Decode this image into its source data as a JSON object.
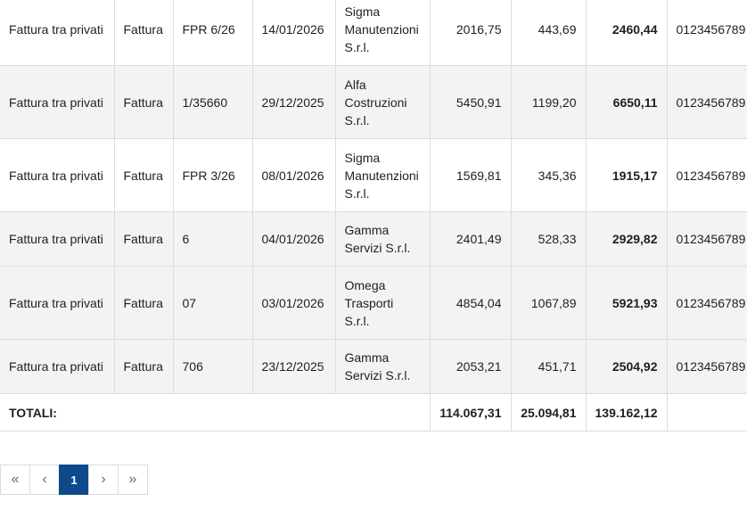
{
  "rows": [
    {
      "tipo": "Fattura tra privati",
      "documento": "Fattura",
      "numero": "FPR 6/26",
      "data": "14/01/2026",
      "fornitore": "Sigma Manutenzioni S.r.l.",
      "imponibile": "2016,75",
      "iva": "443,69",
      "totale": "2460,44",
      "piva": "0123456789"
    },
    {
      "tipo": "Fattura tra privati",
      "documento": "Fattura",
      "numero": "1/35660",
      "data": "29/12/2025",
      "fornitore": "Alfa Costruzioni S.r.l.",
      "imponibile": "5450,91",
      "iva": "1199,20",
      "totale": "6650,11",
      "piva": "0123456789"
    },
    {
      "tipo": "Fattura tra privati",
      "documento": "Fattura",
      "numero": "FPR 3/26",
      "data": "08/01/2026",
      "fornitore": "Sigma Manutenzioni S.r.l.",
      "imponibile": "1569,81",
      "iva": "345,36",
      "totale": "1915,17",
      "piva": "0123456789"
    },
    {
      "tipo": "Fattura tra privati",
      "documento": "Fattura",
      "numero": "6",
      "data": "04/01/2026",
      "fornitore": "Gamma Servizi S.r.l.",
      "imponibile": "2401,49",
      "iva": "528,33",
      "totale": "2929,82",
      "piva": "0123456789"
    },
    {
      "tipo": "Fattura tra privati",
      "documento": "Fattura",
      "numero": "07",
      "data": "03/01/2026",
      "fornitore": "Omega Trasporti S.r.l.",
      "imponibile": "4854,04",
      "iva": "1067,89",
      "totale": "5921,93",
      "piva": "0123456789"
    },
    {
      "tipo": "Fattura tra privati",
      "documento": "Fattura",
      "numero": "706",
      "data": "23/12/2025",
      "fornitore": "Gamma Servizi S.r.l.",
      "imponibile": "2053,21",
      "iva": "451,71",
      "totale": "2504,92",
      "piva": "0123456789"
    }
  ],
  "totals": {
    "label": "TOTALI:",
    "imponibile": "114.067,31",
    "iva": "25.094,81",
    "totale": "139.162,12"
  },
  "pagination": {
    "first": "«",
    "prev": "‹",
    "current": "1",
    "next": "›",
    "last": "»"
  }
}
